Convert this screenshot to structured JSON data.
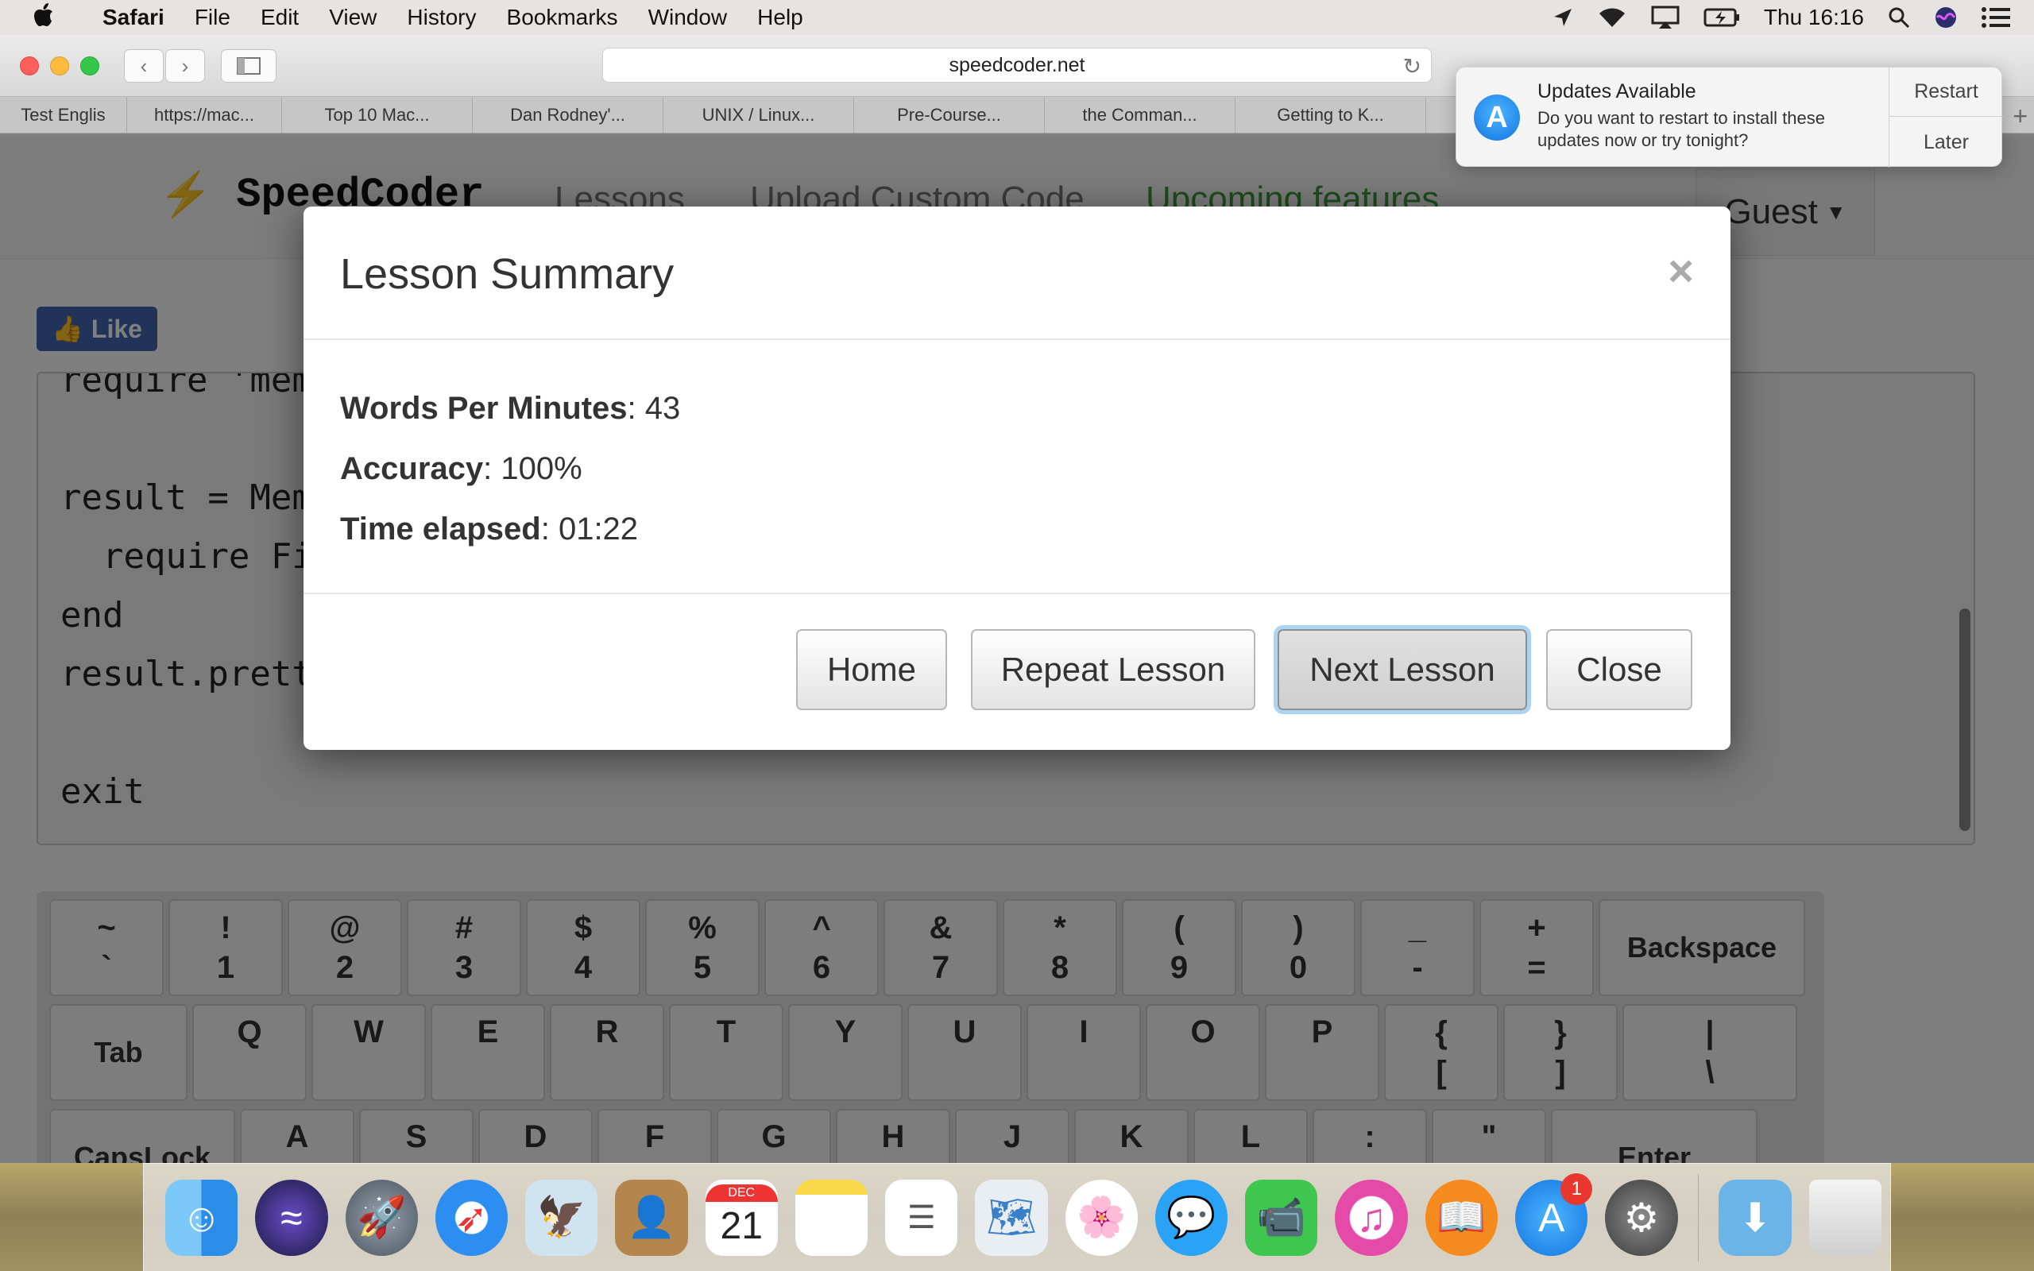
{
  "menubar": {
    "app_name": "Safari",
    "items": [
      "File",
      "Edit",
      "View",
      "History",
      "Bookmarks",
      "Window",
      "Help"
    ],
    "clock": "Thu 16:16"
  },
  "browser": {
    "url": "speedcoder.net",
    "tabs": [
      "Test Englis",
      "https://mac...",
      "Top 10 Mac...",
      "Dan Rodney'...",
      "UNIX / Linux...",
      "Pre-Course...",
      "the Comman...",
      "Getting to K..."
    ]
  },
  "notification": {
    "title": "Updates Available",
    "message": "Do you want to restart to install these updates now or try tonight?",
    "action_primary": "Restart",
    "action_secondary": "Later"
  },
  "site": {
    "brand": "SpeedCoder",
    "nav": [
      "Lessons",
      "Upload Custom Code",
      "Upcoming features"
    ],
    "user_menu": "Guest",
    "like_label": "Like",
    "code_lines": [
      "require 'mem",
      "",
      "result = Mem",
      "  require Fi",
      "end",
      "result.prett",
      "",
      "exit"
    ]
  },
  "keyboard": {
    "row1": [
      [
        "~",
        "`"
      ],
      [
        "!",
        "1"
      ],
      [
        "@",
        "2"
      ],
      [
        "#",
        "3"
      ],
      [
        "$",
        "4"
      ],
      [
        "%",
        "5"
      ],
      [
        "^",
        "6"
      ],
      [
        "&",
        "7"
      ],
      [
        "*",
        "8"
      ],
      [
        "(",
        "9"
      ],
      [
        ")",
        "0"
      ],
      [
        "_",
        "-"
      ],
      [
        "+",
        "="
      ]
    ],
    "row1_end": "Backspace",
    "row2_start": "Tab",
    "row2": [
      "Q",
      "W",
      "E",
      "R",
      "T",
      "Y",
      "U",
      "I",
      "O",
      "P"
    ],
    "row2_brackets": [
      [
        "{",
        "["
      ],
      [
        "}",
        "]"
      ],
      [
        "|",
        "\\"
      ]
    ],
    "row3_start": "CapsLock",
    "row3": [
      "A",
      "S",
      "D",
      "F",
      "G",
      "H",
      "J",
      "K",
      "L",
      ":",
      "\""
    ],
    "row3_end": "Enter"
  },
  "modal": {
    "title": "Lesson Summary",
    "close_glyph": "×",
    "stats": [
      {
        "label": "Words Per Minutes",
        "value": "43"
      },
      {
        "label": "Accuracy",
        "value": "100%"
      },
      {
        "label": "Time elapsed",
        "value": "01:22"
      }
    ],
    "buttons": {
      "home": "Home",
      "repeat": "Repeat Lesson",
      "next": "Next Lesson",
      "close": "Close"
    }
  },
  "dock": {
    "calendar_month": "DEC",
    "calendar_day": "21",
    "app_store_badge": "1"
  }
}
